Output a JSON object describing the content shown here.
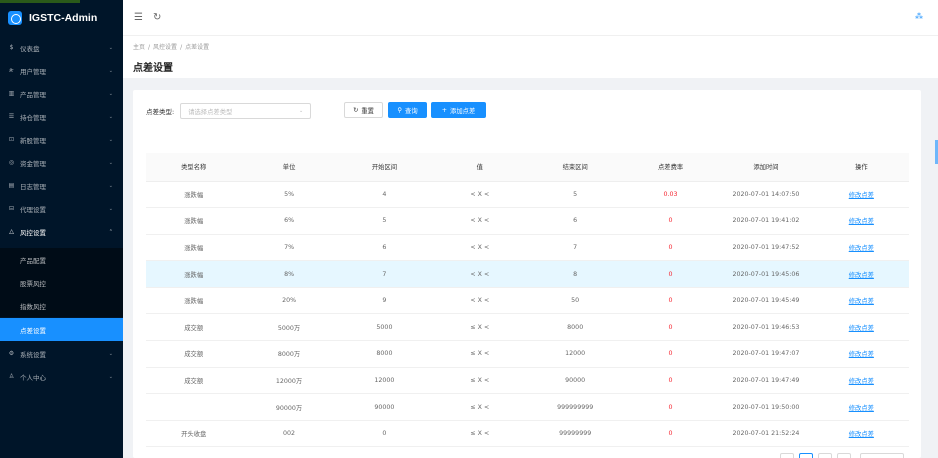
{
  "app": {
    "title": "IGSTC-Admin"
  },
  "sidebar": {
    "items": [
      {
        "label": "仪表盘",
        "icon": "dashboard-icon",
        "glyph": "$"
      },
      {
        "label": "用户管理",
        "icon": "users-icon",
        "glyph": "ጽ"
      },
      {
        "label": "产品管理",
        "icon": "chart-icon",
        "glyph": "▥"
      },
      {
        "label": "持仓管理",
        "icon": "list-icon",
        "glyph": "☰"
      },
      {
        "label": "新股管理",
        "icon": "new-stock-icon",
        "glyph": "⊡"
      },
      {
        "label": "资金管理",
        "icon": "money-icon",
        "glyph": "◎"
      },
      {
        "label": "日志管理",
        "icon": "log-icon",
        "glyph": "▤"
      },
      {
        "label": "代理设置",
        "icon": "agent-icon",
        "glyph": "⊟"
      },
      {
        "label": "风控设置",
        "icon": "risk-icon",
        "glyph": "△"
      }
    ],
    "submenu": [
      {
        "label": "产品配置"
      },
      {
        "label": "股票风控"
      },
      {
        "label": "指数风控"
      },
      {
        "label": "点差设置"
      }
    ],
    "bottom_items": [
      {
        "label": "系统设置",
        "icon": "settings-icon",
        "glyph": "⚙"
      },
      {
        "label": "个人中心",
        "icon": "person-icon",
        "glyph": "♙"
      }
    ]
  },
  "breadcrumb": {
    "home": "主页",
    "level2": "风控设置",
    "level3": "点差设置"
  },
  "page_title": "点差设置",
  "filter": {
    "label": "点差类型:",
    "placeholder": "请选择点差类型",
    "reset_label": "重置",
    "search_label": "查询",
    "add_label": "添加点差"
  },
  "table": {
    "headers": [
      "类型名称",
      "单位",
      "开始区间",
      "值",
      "结束区间",
      "点差费率",
      "添加时间",
      "操作"
    ],
    "rows": [
      [
        "涨跌幅",
        "5%",
        "4",
        "< X <",
        "5",
        "0.03",
        "2020-07-01 14:07:50",
        "修改点差"
      ],
      [
        "涨跌幅",
        "6%",
        "5",
        "< X <",
        "6",
        "0",
        "2020-07-01 19:41:02",
        "修改点差"
      ],
      [
        "涨跌幅",
        "7%",
        "6",
        "< X <",
        "7",
        "0",
        "2020-07-01 19:47:52",
        "修改点差"
      ],
      [
        "涨跌幅",
        "8%",
        "7",
        "< X <",
        "8",
        "0",
        "2020-07-01 19:45:06",
        "修改点差"
      ],
      [
        "涨跌幅",
        "20%",
        "9",
        "< X <",
        "50",
        "0",
        "2020-07-01 19:45:49",
        "修改点差"
      ],
      [
        "成交额",
        "5000万",
        "5000",
        "≤ X <",
        "8000",
        "0",
        "2020-07-01 19:46:53",
        "修改点差"
      ],
      [
        "成交额",
        "8000万",
        "8000",
        "≤ X <",
        "12000",
        "0",
        "2020-07-01 19:47:07",
        "修改点差"
      ],
      [
        "成交额",
        "12000万",
        "12000",
        "≤ X <",
        "90000",
        "0",
        "2020-07-01 19:47:49",
        "修改点差"
      ],
      [
        "",
        "90000万",
        "90000",
        "≤ X <",
        "999999999",
        "0",
        "2020-07-01 19:50:00",
        "修改点差"
      ],
      [
        "开头收盘",
        "002",
        "0",
        "≤ X <",
        "99999999",
        "0",
        "2020-07-01 21:52:24",
        "修改点差"
      ]
    ],
    "highlighted_row": 3
  },
  "colors": {
    "sidebar_bg": "#001529",
    "accent": "#1890ff",
    "danger": "#f5222d"
  }
}
